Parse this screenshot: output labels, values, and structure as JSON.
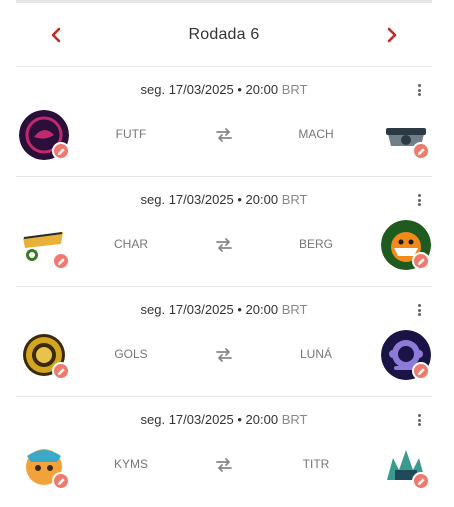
{
  "header": {
    "round_title": "Rodada 6"
  },
  "matches": [
    {
      "date": "seg. 17/03/2025 • 20:00",
      "timezone": "BRT",
      "home": {
        "name": "FUTF",
        "logo_color": "#2a0f3a",
        "logo_accent": "#c02a6a"
      },
      "away": {
        "name": "MACH",
        "logo_color": "#6f8088",
        "logo_accent": "#2c3a44"
      }
    },
    {
      "date": "seg. 17/03/2025 • 20:00",
      "timezone": "BRT",
      "home": {
        "name": "CHAR",
        "logo_color": "#e8b23a",
        "logo_accent": "#3a7a2a"
      },
      "away": {
        "name": "BERG",
        "logo_color": "#1f5a1f",
        "logo_accent": "#f08a1a"
      }
    },
    {
      "date": "seg. 17/03/2025 • 20:00",
      "timezone": "BRT",
      "home": {
        "name": "GOLS",
        "logo_color": "#d4a51e",
        "logo_accent": "#3a2a0a"
      },
      "away": {
        "name": "LUNÁ",
        "logo_color": "#1a1446",
        "logo_accent": "#8e7ad8"
      }
    },
    {
      "date": "seg. 17/03/2025 • 20:00",
      "timezone": "BRT",
      "home": {
        "name": "KYMS",
        "logo_color": "#f2a23a",
        "logo_accent": "#3aa8c8"
      },
      "away": {
        "name": "TITR",
        "logo_color": "#3a9a8e",
        "logo_accent": "#1f4a5a"
      }
    }
  ],
  "colors": {
    "accent": "#c62a2a",
    "edit_badge": "#f07a6e",
    "divider": "#e6e6e6"
  },
  "icons": {
    "prev": "chevron-left-icon",
    "next": "chevron-right-icon",
    "swap": "swap-icon",
    "more": "more-vert-icon",
    "edit": "pencil-icon"
  }
}
